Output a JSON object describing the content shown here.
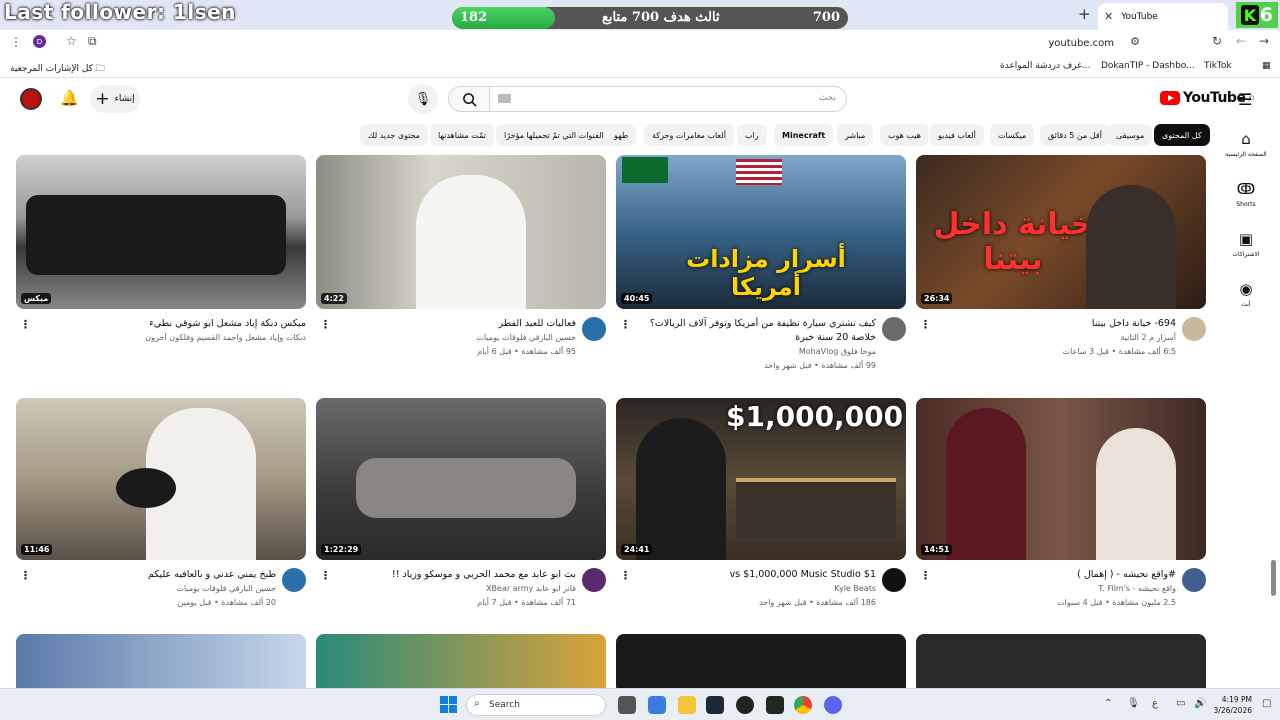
{
  "overlay": {
    "follower_text": "Last follower: 1lsen",
    "goal_current": "182",
    "goal_target": "700",
    "goal_label": "ثالث هدف 700 متابع",
    "goal_progress": 0.26
  },
  "browser": {
    "tab_title": "YouTube",
    "url": "youtube.com",
    "profile_initial": "D",
    "kick_count": "6",
    "kick_letter": "K",
    "bookmarks": [
      "كل الإشارات المرجعية",
      "TikTok",
      "DokanTIP - Dashbo...",
      "غرف دردشة المواعدة..."
    ]
  },
  "header": {
    "create_label": "إنشاء",
    "search_placeholder": "بحث",
    "logo_text": "YouTube",
    "logo_region": "JO"
  },
  "chips": [
    "كل المحتوى",
    "موسيقى",
    "أقل من 5 دقائق",
    "ميكسات",
    "ألعاب فيديو",
    "هيب هوب",
    "مباشر",
    "Minecraft",
    "راب",
    "ألعاب مغامرات وحركة",
    "طهو",
    "الفنوات التي تمّ تحميلها مؤخرًا",
    "تمّت مشاهدتها",
    "محتوى جديد لك"
  ],
  "sidenav": {
    "home": "الصفحة الرئيسية",
    "shorts": "Shorts",
    "subs": "الاشتراكات",
    "you": "أنت"
  },
  "videos": [
    {
      "title": "694- خيانة داخل بيتنا",
      "channel": "أسرار م 2 الثانية",
      "stats": "6.5 ألف مشاهدة • قبل 3 ساعات",
      "duration": "26:34",
      "thumb_text": "خيانة داخل بيتنا"
    },
    {
      "title": "كيف تشتري سيارة نظيفة من أمريكا وتوفر آلاف الريالات؟ خلاصة 20 سنة خبرة",
      "channel": "موحا فلوق MohaVlog",
      "stats": "99 ألف مشاهدة • قبل شهر واحد",
      "duration": "40:45",
      "thumb_text": "أسرار مزادات أمريكا"
    },
    {
      "title": "فعاليات للعيد الفطر",
      "channel": "حسين البارقي فلوقات يوميات",
      "stats": "95 ألف مشاهدة • قبل 6 أيام",
      "duration": "4:22",
      "thumb_text": ""
    },
    {
      "title": "ميكس دبكة إياد مشعل   ابو شوقي   بطيء",
      "channel": "دبكات وإياد مشعل واحمد القسيم وفلكون آخرون",
      "stats": "",
      "duration": "ميكس",
      "thumb_text": ""
    },
    {
      "title": "#واقع نحيشه - ( إهمال )",
      "channel": "واقع نحيشه - T. Film's",
      "stats": "2.5 مليون مشاهدة • قبل 4 سنوات",
      "duration": "14:51",
      "thumb_text": ""
    },
    {
      "title": "$1 vs $1,000,000 Music Studio",
      "channel": "Kyle Beats",
      "stats": "186 ألف مشاهدة • قبل شهر واحد",
      "duration": "24:41",
      "thumb_text": "$1,000,000"
    },
    {
      "title": "بث ابو عابد مع محمد الحربي و موسكو وزياد !!",
      "channel": "فانز ابو عابد XBear army",
      "stats": "71 ألف مشاهدة • قبل 7 أيام",
      "duration": "1:22:29",
      "thumb_text": ""
    },
    {
      "title": "طبخ يمني عدني و بالعافيه عليكم",
      "channel": "حسين البارقي فلوقات يوميات",
      "stats": "20 ألف مشاهدة • قبل يومين",
      "duration": "11:46",
      "thumb_text": ""
    }
  ],
  "taskbar": {
    "search_label": "Search",
    "time": "4:19 PM",
    "date": "3/26/2026",
    "lang": "ع"
  },
  "colors": {
    "yt_red": "#ff0000",
    "goal_green": "#3cc356",
    "kick_green": "#53fc18"
  }
}
